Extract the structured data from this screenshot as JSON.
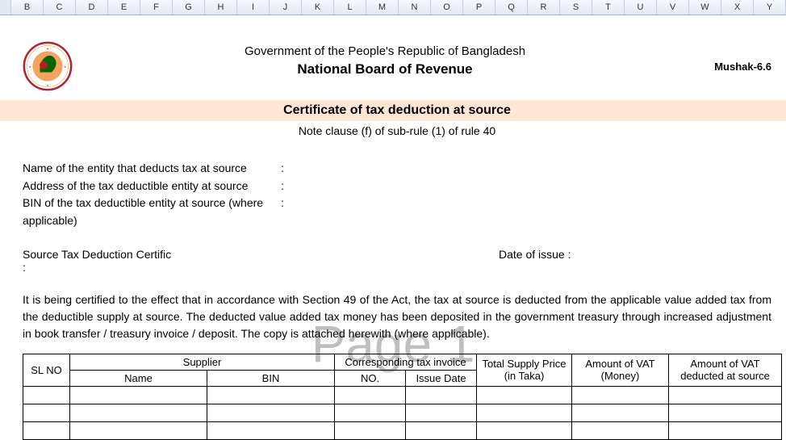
{
  "columns": [
    "",
    "B",
    "C",
    "D",
    "E",
    "F",
    "G",
    "H",
    "I",
    "J",
    "K",
    "L",
    "M",
    "N",
    "O",
    "P",
    "Q",
    "R",
    "S",
    "T",
    "U",
    "V",
    "W",
    "X",
    "Y"
  ],
  "header": {
    "gov_line": "Government of the People's Republic of Bangladesh",
    "nbr_line": "National Board of Revenue",
    "form_code": "Mushak-6.6"
  },
  "cert": {
    "title": "Certificate of tax deduction at source",
    "note": "Note clause (f) of sub-rule (1) of rule 40"
  },
  "fields": {
    "entity_name_label": "Name of the entity that deducts tax at source",
    "entity_addr_label": "Address of the tax deductible entity at source",
    "entity_bin_label": "BIN of the tax deductible entity at source (where applicable)",
    "cert_no_label": "Source Tax Deduction Certific :",
    "issue_date_label": "Date of issue  :",
    "colon": ":"
  },
  "paragraph": "It is being certified to the effect that in accordance with Section 49 of the Act, the tax at source is deducted from the applicable value added tax from the deductible supply at source. The deducted value added tax money has been deposited in the government treasury through increased adjustment in book transfer / treasury invoice / deposit. The copy is attached herewith (where applicable).",
  "watermark": "Page 1",
  "table": {
    "h_sl": "SL NO",
    "h_supplier": "Supplier",
    "h_name": "Name",
    "h_bin": "BIN",
    "h_invoice": "Corresponding tax invoice",
    "h_no": "NO.",
    "h_issue": "Issue Date",
    "h_price": "Total Supply Price (in Taka)",
    "h_money": "Amount of VAT (Money)",
    "h_ded": "Amount of VAT deducted at source"
  }
}
